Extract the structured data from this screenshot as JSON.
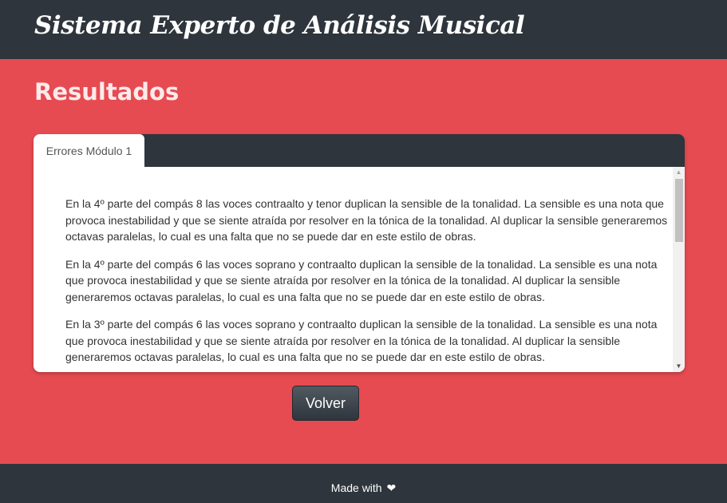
{
  "navbar": {
    "brand": "Sistema Experto de Análisis Musical"
  },
  "page": {
    "heading": "Resultados"
  },
  "tabs": [
    {
      "label": "Errores Módulo 1"
    }
  ],
  "messages": [
    "En la 4º parte del compás 8 las voces contraalto y tenor duplican la sensible de la tonalidad. La sensible es una nota que provoca inestabilidad y que se siente atraída por resolver en la tónica de la tonalidad. Al duplicar la sensible generaremos octavas paralelas, lo cual es una falta que no se puede dar en este estilo de obras.",
    "En la 4º parte del compás 6 las voces soprano y contraalto duplican la sensible de la tonalidad. La sensible es una nota que provoca inestabilidad y que se siente atraída por resolver en la tónica de la tonalidad. Al duplicar la sensible generaremos octavas paralelas, lo cual es una falta que no se puede dar en este estilo de obras.",
    "En la 3º parte del compás 6 las voces soprano y contraalto duplican la sensible de la tonalidad. La sensible es una nota que provoca inestabilidad y que se siente atraída por resolver en la tónica de la tonalidad. Al duplicar la sensible generaremos octavas paralelas, lo cual es una falta que no se puede dar en este estilo de obras."
  ],
  "actions": {
    "back_label": "Volver"
  },
  "footer": {
    "text": "Made with",
    "icon": "heart-icon"
  },
  "colors": {
    "background": "#e64b51",
    "navbar": "#2e353c",
    "panel": "#ffffff"
  }
}
